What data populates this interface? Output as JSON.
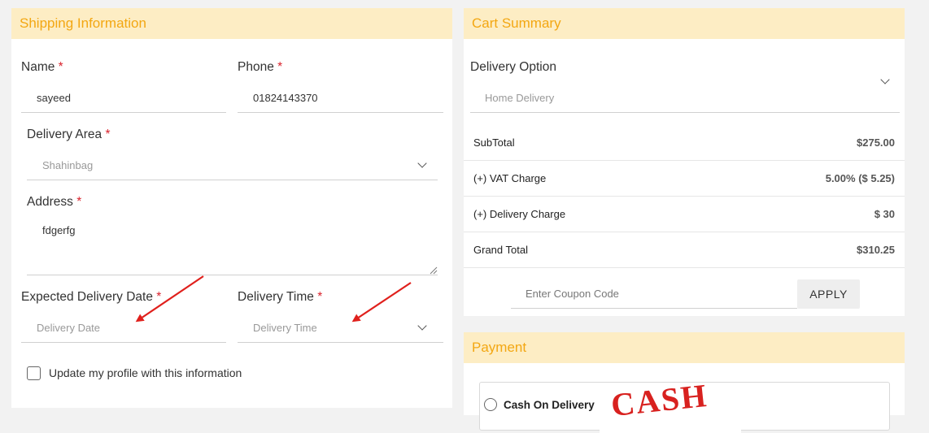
{
  "shipping": {
    "title": "Shipping Information",
    "name_label": "Name",
    "name_value": "sayeed",
    "phone_label": "Phone",
    "phone_value": "01824143370",
    "area_label": "Delivery Area",
    "area_value": "Shahinbag",
    "address_label": "Address",
    "address_value": "fdgerfg",
    "date_label": "Expected Delivery Date",
    "date_placeholder": "Delivery Date",
    "time_label": "Delivery Time",
    "time_placeholder": "Delivery Time",
    "update_profile_label": "Update my profile with this information",
    "update_profile_checked": false,
    "required_mark": "*"
  },
  "cart": {
    "title": "Cart Summary",
    "delivery_option_label": "Delivery Option",
    "delivery_option_value": "Home Delivery",
    "rows": [
      {
        "label": "SubTotal",
        "value": "$275.00"
      },
      {
        "label": "(+) VAT Charge",
        "value": "5.00% ($ 5.25)"
      },
      {
        "label": "(+) Delivery Charge",
        "value": "$ 30"
      },
      {
        "label": "Grand Total",
        "value": "$310.25"
      }
    ],
    "coupon_placeholder": "Enter Coupon Code",
    "apply_label": "APPLY"
  },
  "payment": {
    "title": "Payment",
    "option_label": "Cash On Delivery",
    "option_image_text": "CASH"
  },
  "colors": {
    "header_bg": "#fdedc4",
    "header_text": "#f3a712",
    "required": "#d9232d",
    "annotation_arrow": "#e0201c",
    "stamp": "#d8211f"
  }
}
